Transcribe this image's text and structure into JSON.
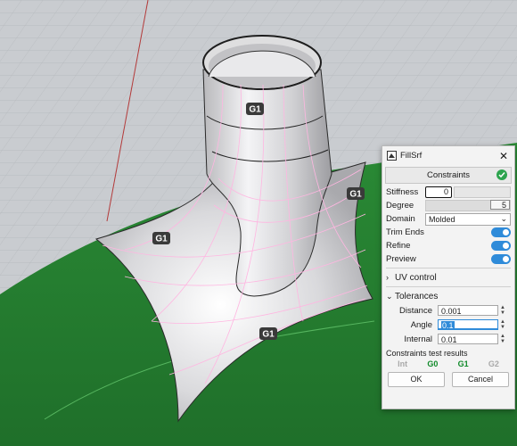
{
  "viewport": {
    "continuity_labels": [
      "G1",
      "G1",
      "G1",
      "G1"
    ],
    "colors": {
      "background": "#c9ccd0",
      "grid": "#b4b8bc",
      "green_surface": "#2e8b3a",
      "fill_surface": "#e8e8ea",
      "isocurves": "#ffb6e1"
    }
  },
  "panel": {
    "title": "FillSrf",
    "constraints_label": "Constraints",
    "stiffness": {
      "label": "Stiffness",
      "value": "0"
    },
    "degree": {
      "label": "Degree",
      "value": "5"
    },
    "domain": {
      "label": "Domain",
      "value": "Molded"
    },
    "toggles": [
      {
        "label": "Trim Ends",
        "on": true
      },
      {
        "label": "Refine",
        "on": true
      },
      {
        "label": "Preview",
        "on": true
      }
    ],
    "uv_control_label": "UV control",
    "tolerances_label": "Tolerances",
    "tolerances": [
      {
        "label": "Distance",
        "value": "0.001"
      },
      {
        "label": "Angle",
        "value": "0.1"
      },
      {
        "label": "Internal",
        "value": "0.01"
      }
    ],
    "results_title": "Constraints test results",
    "results": [
      {
        "label": "Int",
        "state": "dim"
      },
      {
        "label": "G0",
        "state": "good"
      },
      {
        "label": "G1",
        "state": "good"
      },
      {
        "label": "G2",
        "state": "dim"
      }
    ],
    "ok_label": "OK",
    "cancel_label": "Cancel"
  }
}
